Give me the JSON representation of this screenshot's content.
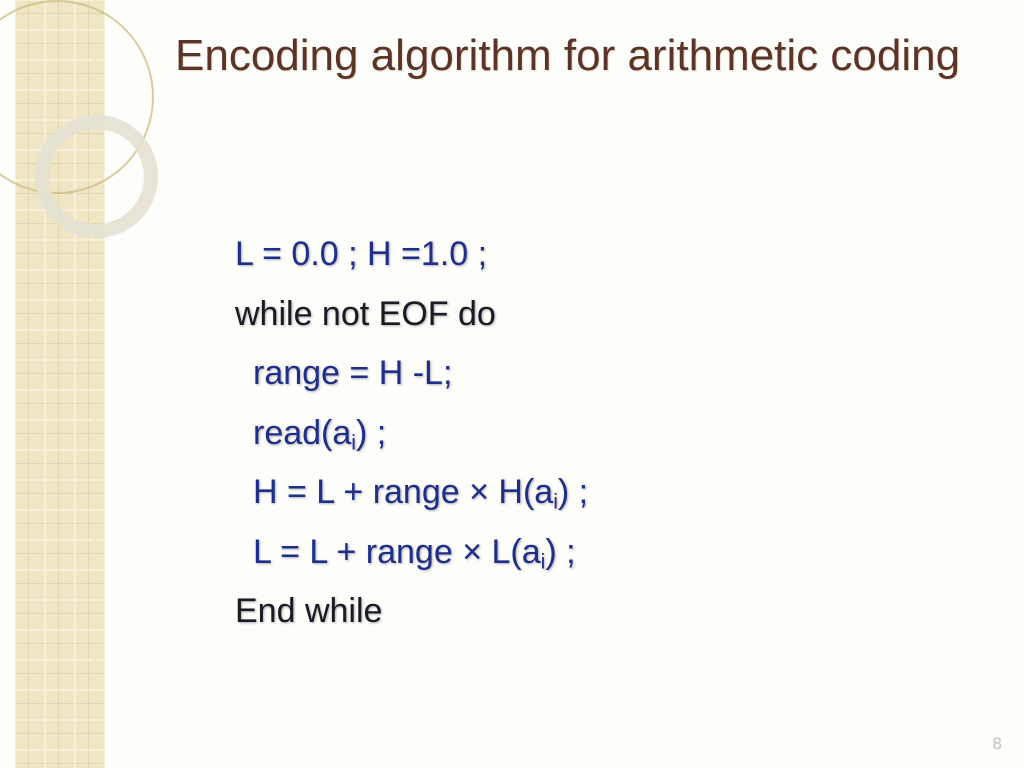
{
  "title": "Encoding algorithm for arithmetic coding",
  "lines": {
    "l1a": "L = 0.0 ; H =1.0 ;",
    "l2": "while not EOF do",
    "l3": "range = H -L;",
    "l4a": "read(a",
    "l4b": "i",
    "l4c": ") ;",
    "l5a": "H = L + range × H(a",
    "l5b": "i",
    "l5c": ") ;",
    "l6a": "L = L + range ×  L(a",
    "l6b": "i",
    "l6c": ") ;",
    "l7": "End while"
  },
  "page": "8"
}
